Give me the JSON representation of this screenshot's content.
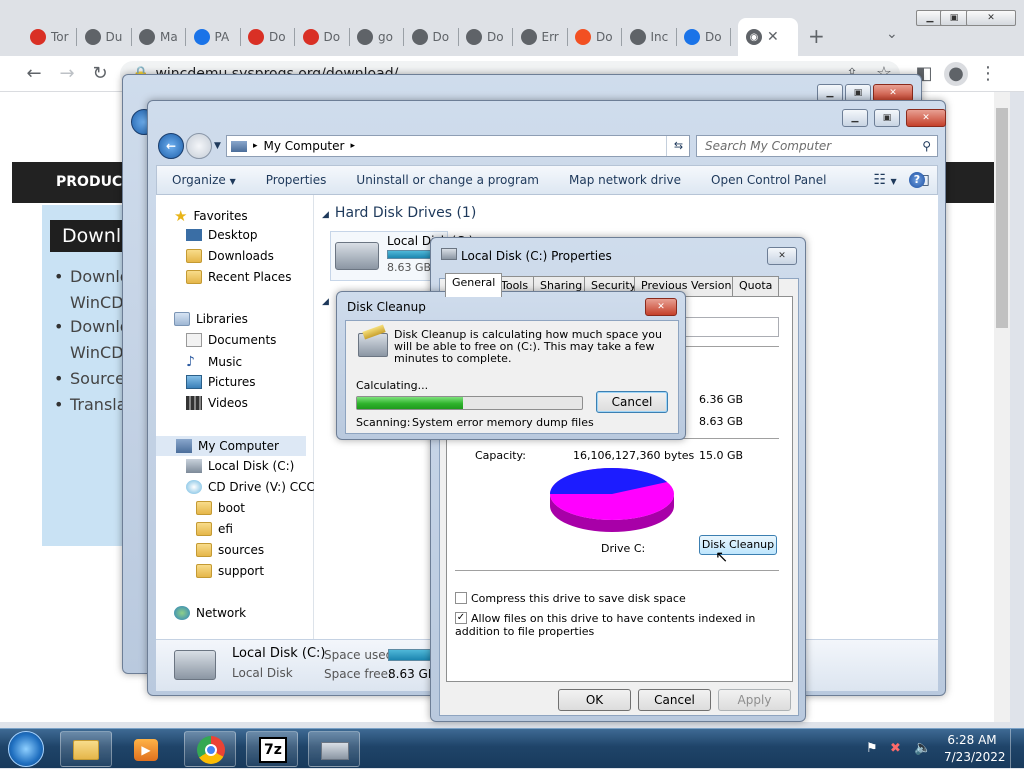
{
  "browser": {
    "tabs": [
      {
        "label": "Tor",
        "icon": "tor-icon",
        "color": "#d93025"
      },
      {
        "label": "Du",
        "icon": "download-circle-icon",
        "color": "#5f6368"
      },
      {
        "label": "Ma",
        "icon": "globe-icon",
        "color": "#5f6368"
      },
      {
        "label": "PA",
        "icon": "pa-icon",
        "color": "#1a73e8"
      },
      {
        "label": "Do",
        "icon": "m-icon",
        "color": "#d93025"
      },
      {
        "label": "Do",
        "icon": "m-icon",
        "color": "#d93025"
      },
      {
        "label": "go",
        "icon": "globe-icon",
        "color": "#5f6368"
      },
      {
        "label": "Do",
        "icon": "globe-icon",
        "color": "#5f6368"
      },
      {
        "label": "Do",
        "icon": "globe-icon",
        "color": "#5f6368"
      },
      {
        "label": "Err",
        "icon": "globe-icon",
        "color": "#5f6368"
      },
      {
        "label": "Do",
        "icon": "microsoft-icon",
        "color": "#f25022"
      },
      {
        "label": "Inc",
        "icon": "incognito-icon",
        "color": "#5f6368"
      },
      {
        "label": "Do",
        "icon": "download-icon",
        "color": "#1a73e8"
      }
    ],
    "new_tab": "+",
    "url": "wincdemu.sysprogs.org/download/"
  },
  "website": {
    "nav_label": "PRODUCT",
    "heading": "Downlo",
    "list": [
      "Downlo",
      "WinCD",
      "Downlo",
      "WinCD",
      "Source",
      "Transla"
    ],
    "bullets": [
      "•",
      "•",
      "•",
      "•"
    ]
  },
  "explorer": {
    "address": "My Computer",
    "search_placeholder": "Search My Computer",
    "toolbar": [
      "Organize",
      "Properties",
      "Uninstall or change a program",
      "Map network drive",
      "Open Control Panel"
    ],
    "nav": {
      "favorites": "Favorites",
      "desktop": "Desktop",
      "downloads": "Downloads",
      "recent": "Recent Places",
      "libraries": "Libraries",
      "documents": "Documents",
      "music": "Music",
      "pictures": "Pictures",
      "videos": "Videos",
      "computer": "My Computer",
      "local_disk": "Local Disk (C:)",
      "cd_drive": "CD Drive (V:) CCCOI",
      "boot": "boot",
      "efi": "efi",
      "sources": "sources",
      "support": "support",
      "network": "Network"
    },
    "group_header": "Hard Disk Drives (1)",
    "drive_name": "Local Disk (C:)",
    "drive_free_short": "8.63 GB",
    "details": {
      "name": "Local Disk (C:)",
      "type": "Local Disk",
      "space_used_label": "Space used:",
      "space_free_label": "Space free:",
      "space_free": "8.63 GB",
      "used_fraction": 0.43
    }
  },
  "properties": {
    "title": "Local Disk (C:) Properties",
    "tabs": [
      "General",
      "Tools",
      "Sharing",
      "Security",
      "Previous Versions",
      "Quota"
    ],
    "used_value": "6.36 GB",
    "free_value": "8.63 GB",
    "capacity_label": "Capacity:",
    "capacity_bytes": "16,106,127,360 bytes",
    "capacity_gb": "15.0 GB",
    "drive_label": "Drive C:",
    "disk_cleanup_button": "Disk Cleanup",
    "compress_label": "Compress this drive to save disk space",
    "index_label": "Allow files on this drive to have contents indexed in addition to file properties",
    "ok": "OK",
    "cancel": "Cancel",
    "apply": "Apply",
    "used_color": "#1c1cff",
    "free_color": "#ff00ff",
    "used_fraction": 0.424
  },
  "cleanup": {
    "title": "Disk Cleanup",
    "message": "Disk Cleanup is calculating how much space you will be able to free on  (C:). This may take a few minutes to complete.",
    "calculating": "Calculating...",
    "cancel": "Cancel",
    "scanning_label": "Scanning:",
    "scanning_item": "System error memory dump files",
    "progress": 0.47
  },
  "taskbar": {
    "time": "6:28 AM",
    "date": "7/23/2022"
  }
}
